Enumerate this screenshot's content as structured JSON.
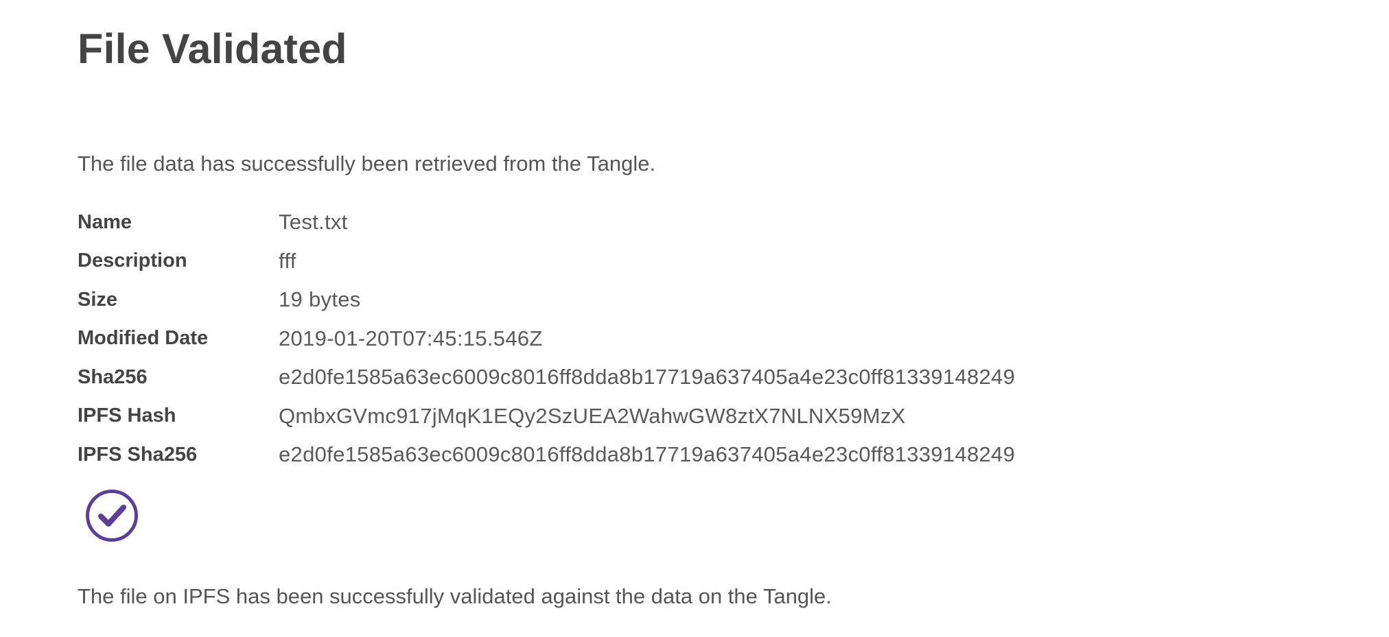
{
  "page": {
    "title": "File Validated",
    "intro": "The file data has successfully been retrieved from the Tangle.",
    "validated_message": "The file on IPFS has been successfully validated against the data on the Tangle.",
    "check_icon": "check-circle-icon",
    "accent_color": "#5c3d99"
  },
  "details": [
    {
      "label": "Name",
      "value": "Test.txt"
    },
    {
      "label": "Description",
      "value": "fff"
    },
    {
      "label": "Size",
      "value": "19 bytes"
    },
    {
      "label": "Modified Date",
      "value": "2019-01-20T07:45:15.546Z"
    },
    {
      "label": "Sha256",
      "value": "e2d0fe1585a63ec6009c8016ff8dda8b17719a637405a4e23c0ff81339148249"
    },
    {
      "label": "IPFS Hash",
      "value": "QmbxGVmc917jMqK1EQy2SzUEA2WahwGW8ztX7NLNX59MzX"
    },
    {
      "label": "IPFS Sha256",
      "value": "e2d0fe1585a63ec6009c8016ff8dda8b17719a637405a4e23c0ff81339148249"
    }
  ]
}
